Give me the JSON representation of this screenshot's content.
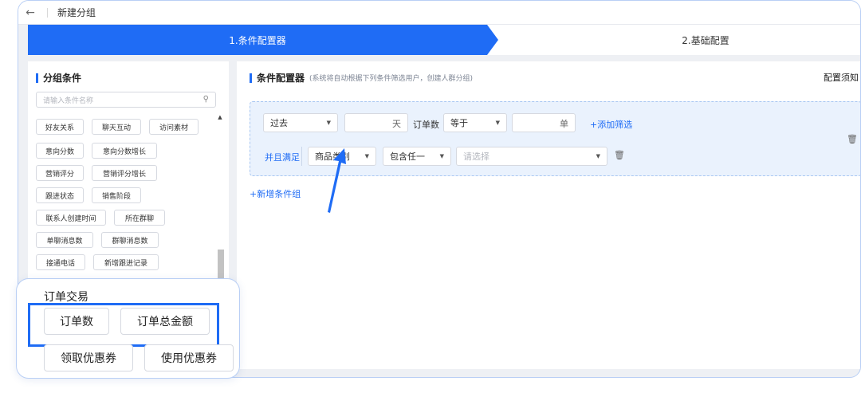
{
  "topbar": {
    "back_icon": "←",
    "title": "新建分组"
  },
  "steps": {
    "step1": "1.条件配置器",
    "step2": "2.基础配置"
  },
  "left_panel": {
    "title": "分组条件",
    "search_placeholder": "请输入条件名称",
    "tags": [
      "好友关系",
      "聊天互动",
      "访问素材",
      "意向分数",
      "意向分数增长",
      "营销评分",
      "营销评分增长",
      "跟进状态",
      "销售阶段",
      "联系人创建时间",
      "所在群聊",
      "单聊消息数",
      "群聊消息数",
      "接通电话",
      "新增跟进记录"
    ]
  },
  "main": {
    "title": "条件配置器",
    "subtitle": "(系统将自动根据下列条件筛选用户，创建人群分组)",
    "notice": "配置须知",
    "row1": {
      "period": "过去",
      "days_unit": "天",
      "metric": "订单数",
      "operator": "等于",
      "count_unit": "单",
      "add_filter": "+添加筛选"
    },
    "row2": {
      "label": "并且满足",
      "category": "商品类别",
      "match": "包含任一",
      "placeholder": "请选择"
    },
    "add_group": "+新增条件组"
  },
  "zoom": {
    "title": "订单交易",
    "tags": [
      "订单数",
      "订单总金额",
      "领取优惠券",
      "使用优惠券"
    ]
  },
  "colors": {
    "primary": "#1f6cf5",
    "panel_bg": "#eef0f4",
    "condition_bg": "#eaf2fd"
  },
  "icons": {
    "search": "search-icon",
    "trash": "trash-icon",
    "chevron": "chevron-down-icon",
    "back": "arrow-left-icon"
  }
}
